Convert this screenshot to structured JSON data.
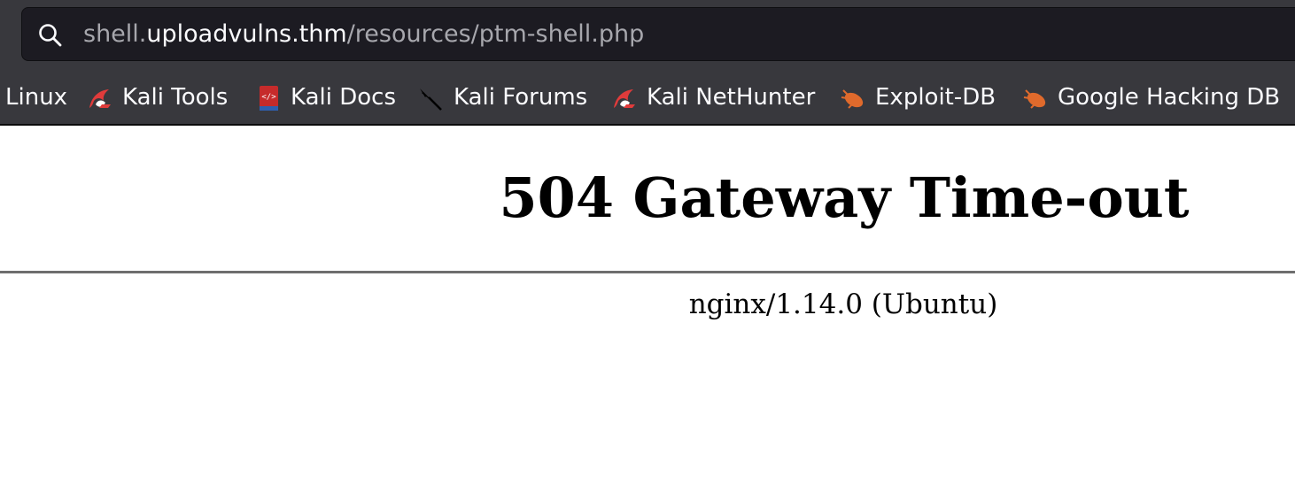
{
  "browser": {
    "urlbar": {
      "url_prefix": "shell.",
      "url_host": "uploadvulns.thm",
      "url_path": "/resources/ptm-shell.php"
    },
    "bookmarks": [
      {
        "label": "Linux",
        "icon": "kali-icon"
      },
      {
        "label": "Kali Tools",
        "icon": "kali-dragon-icon"
      },
      {
        "label": "Kali Docs",
        "icon": "kali-docs-icon"
      },
      {
        "label": "Kali Forums",
        "icon": "kali-forums-icon"
      },
      {
        "label": "Kali NetHunter",
        "icon": "kali-dragon-icon"
      },
      {
        "label": "Exploit-DB",
        "icon": "exploit-db-icon"
      },
      {
        "label": "Google Hacking DB",
        "icon": "exploit-db-icon"
      }
    ]
  },
  "page": {
    "title": "504 Gateway Time-out",
    "server_signature": "nginx/1.14.0 (Ubuntu)"
  },
  "colors": {
    "chrome_bg": "#38383d",
    "urlbar_bg": "#1c1b22",
    "kali_red": "#e03b3b",
    "exploitdb_orange": "#e06a2c"
  }
}
